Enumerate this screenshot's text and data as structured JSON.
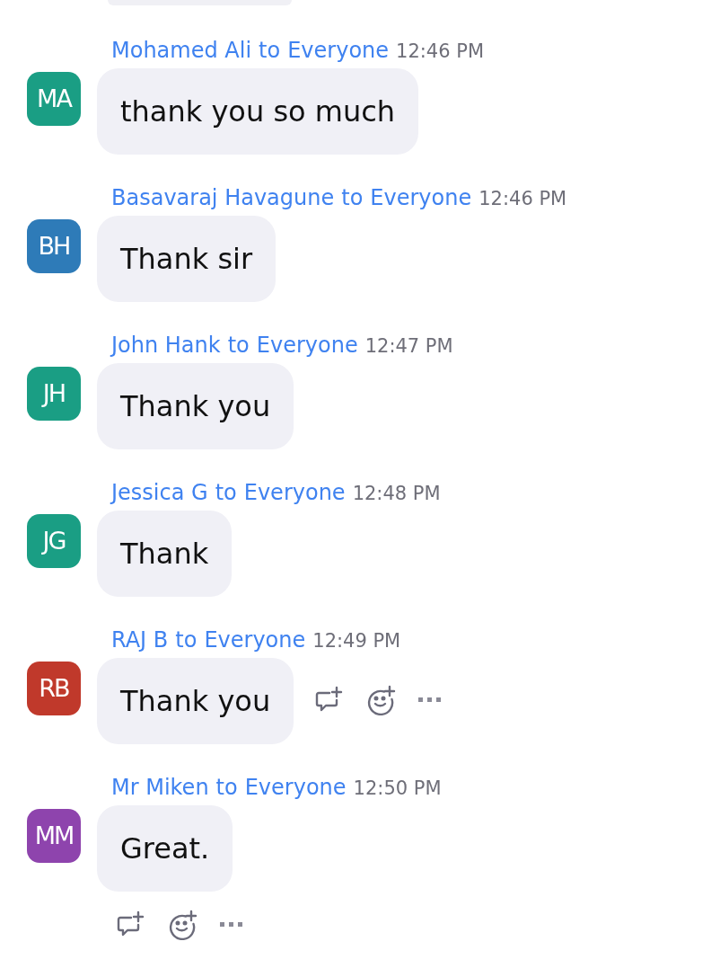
{
  "messages": [
    {
      "sender": "Mohamed Ali",
      "to": "to",
      "recipient": "Everyone",
      "time": "12:46 PM",
      "initials": "MA",
      "color": "#1a9e84",
      "text": "thank you so much",
      "kind": "plain"
    },
    {
      "sender": "Basavaraj Havagune",
      "to": "to",
      "recipient": "Everyone",
      "time": "12:46 PM",
      "initials": "BH",
      "color": "#2e7bb8",
      "text": "Thank sir",
      "kind": "plain"
    },
    {
      "sender": "John Hank",
      "to": "to",
      "recipient": "Everyone",
      "time": "12:47 PM",
      "initials": "JH",
      "color": "#1a9e84",
      "text": "Thank you",
      "kind": "plain"
    },
    {
      "sender": "Jessica G",
      "to": "to",
      "recipient": "Everyone",
      "time": "12:48 PM",
      "initials": "JG",
      "color": "#1a9e84",
      "text": "Thank",
      "kind": "plain"
    },
    {
      "sender": "RAJ B",
      "to": "to",
      "recipient": "Everyone",
      "time": "12:49 PM",
      "initials": "RB",
      "color": "#c0392b",
      "text": "Thank you",
      "kind": "hovered"
    },
    {
      "sender": "Mr Miken",
      "to": "to",
      "recipient": "Everyone",
      "time": "12:50 PM",
      "initials": "MM",
      "color": "#8e44ad",
      "text": "Great.",
      "kind": "last"
    }
  ]
}
